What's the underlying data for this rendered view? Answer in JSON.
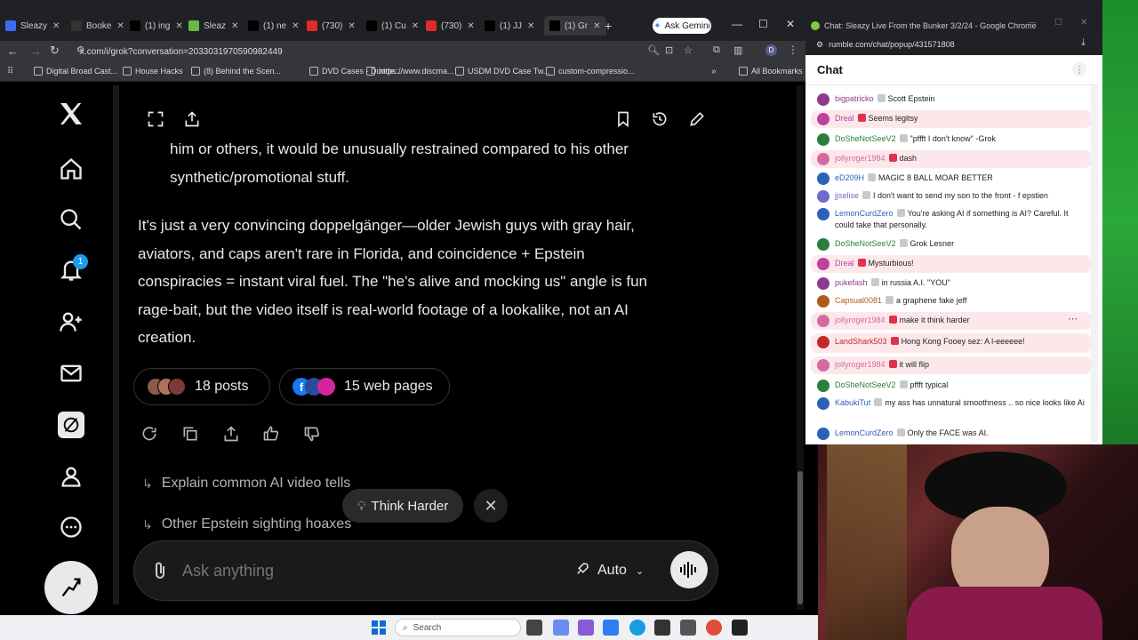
{
  "browser_left": {
    "tabs": [
      {
        "label": "Sleazy",
        "color": "#3b6cf0"
      },
      {
        "label": "Booke",
        "color": "#333"
      },
      {
        "label": "(1) ing",
        "color": "#000"
      },
      {
        "label": "Sleaz",
        "color": "#6bb84a"
      },
      {
        "label": "(1) ne",
        "color": "#000"
      },
      {
        "label": "(730)",
        "color": "#e12a2a"
      },
      {
        "label": "(1) Cu",
        "color": "#000"
      },
      {
        "label": "(730)",
        "color": "#e12a2a"
      },
      {
        "label": "(1) JJ",
        "color": "#000"
      },
      {
        "label": "(1) Gr",
        "color": "#000"
      }
    ],
    "ask_gemini": "Ask Gemini",
    "url": "x.com/i/grok?conversation=2033031970590982449",
    "bookmarks": [
      "Digital Broad Cast...",
      "House Hacks",
      "(8) Behind the Scen...",
      "DVD Cases - Duode...",
      "https://www.discma...",
      "USDM DVD Case Tw...",
      "custom-compressio..."
    ],
    "all_bookmarks": "All Bookmarks"
  },
  "sidebar": {
    "notification_count": "1"
  },
  "grok": {
    "para1_line1": "him or others, it would be unusually restrained compared to his other",
    "para1_line2": "synthetic/promotional stuff.",
    "para2_lines": [
      "It's just a very convincing doppelgänger—older Jewish guys with gray hair,",
      "aviators, and caps aren't rare in Florida, and coincidence + Epstein",
      "conspiracies = instant viral fuel. The \"he's alive and mocking us\" angle is fun",
      "rage-bait, but the video itself is real-world footage of a lookalike, not an AI",
      "creation."
    ],
    "posts_label": "18 posts",
    "web_pages_label": "15 web pages",
    "suggestions": [
      "Explain common AI video tells",
      "Other Epstein sighting hoaxes"
    ],
    "think_harder": "Think Harder",
    "ask_placeholder": "Ask anything",
    "model": "Auto"
  },
  "taskbar": {
    "search_label": "Search"
  },
  "chat_window": {
    "title": "Chat: Sleazy Live From the Bunker 3/2/24 - Google Chrome",
    "url": "rumble.com/chat/popup/431571808",
    "header": "Chat",
    "messages": [
      {
        "user": "bigpatricko",
        "text": "Scott Epstein",
        "color": "#8e3a8e",
        "highlight": false
      },
      {
        "user": "Dreal",
        "text": "Seems legitsy",
        "color": "#c0409c",
        "highlight": true
      },
      {
        "user": "DoSheNotSeeV2",
        "text": "\"pffft I don't know\" -Grok",
        "color": "#2a7f3a",
        "highlight": false
      },
      {
        "user": "jollyroger1984",
        "text": "dash",
        "color": "#d46aa0",
        "highlight": true
      },
      {
        "user": "eD209H",
        "text": "MAGIC 8 BALL MOAR BETTER",
        "color": "#2a62b8",
        "highlight": false
      },
      {
        "user": "jjselise",
        "text": "I don't want to send my son to the front - f epstien",
        "color": "#6b6bd0",
        "highlight": false
      },
      {
        "user": "LemonCurdZero",
        "text": "You're asking AI if something is AI? Careful. It could take that personally.",
        "color": "#2a62b8",
        "highlight": false
      },
      {
        "user": "DoSheNotSeeV2",
        "text": "Grok Lesner",
        "color": "#2a7f3a",
        "highlight": false
      },
      {
        "user": "Dreal",
        "text": "Mysturbious!",
        "color": "#c0409c",
        "highlight": true
      },
      {
        "user": "pukefash",
        "text": "in russia A.I. \"YOU\"",
        "color": "#8e3a8e",
        "highlight": false
      },
      {
        "user": "Capsual0081",
        "text": "a graphene fake jeff",
        "color": "#b05a1a",
        "highlight": false
      },
      {
        "user": "jollyroger1984",
        "text": "make it think harder",
        "color": "#d46aa0",
        "highlight": true
      },
      {
        "user": "LandShark503",
        "text": "Hong Kong Fooey sez: A l-eeeeee!",
        "color": "#c02a2a",
        "highlight": true
      },
      {
        "user": "jollyroger1984",
        "text": "it will flip",
        "color": "#d46aa0",
        "highlight": true
      },
      {
        "user": "DoSheNotSeeV2",
        "text": "pffft typical",
        "color": "#2a7f3a",
        "highlight": false
      },
      {
        "user": "KabukiTut",
        "text": "my ass has unnatural smoothness .. so nice looks like Ai",
        "color": "#2a62b8",
        "highlight": false
      },
      {
        "user": "LemonCurdZero",
        "text": "Only the FACE was AI.",
        "color": "#2a62b8",
        "highlight": false
      }
    ]
  }
}
